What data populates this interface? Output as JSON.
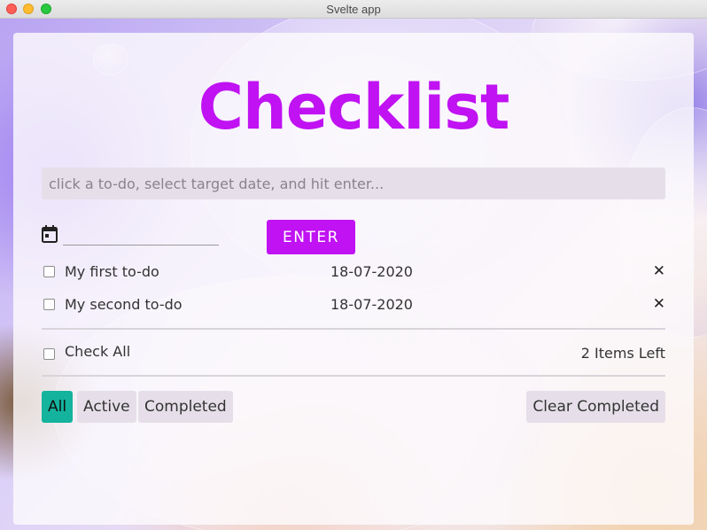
{
  "window": {
    "title": "Svelte app"
  },
  "app": {
    "heading": "Checklist",
    "input_placeholder": "click a to-do, select target date, and hit enter...",
    "enter_label": "ENTER",
    "todos": [
      {
        "text": "My first to-do",
        "date": "18-07-2020",
        "remove": "✕"
      },
      {
        "text": "My second to-do",
        "date": "18-07-2020",
        "remove": "✕"
      }
    ],
    "check_all_label": "Check All",
    "items_left": "2 Items Left",
    "filters": {
      "all": "All",
      "active": "Active",
      "completed": "Completed"
    },
    "active_filter": "All",
    "clear_completed": "Clear Completed"
  },
  "colors": {
    "accent": "#c012f2",
    "filter_active": "#13b39d",
    "input_bg": "#e6dfe9"
  },
  "icons": {
    "date": "calendar-icon",
    "remove": "close-icon"
  }
}
